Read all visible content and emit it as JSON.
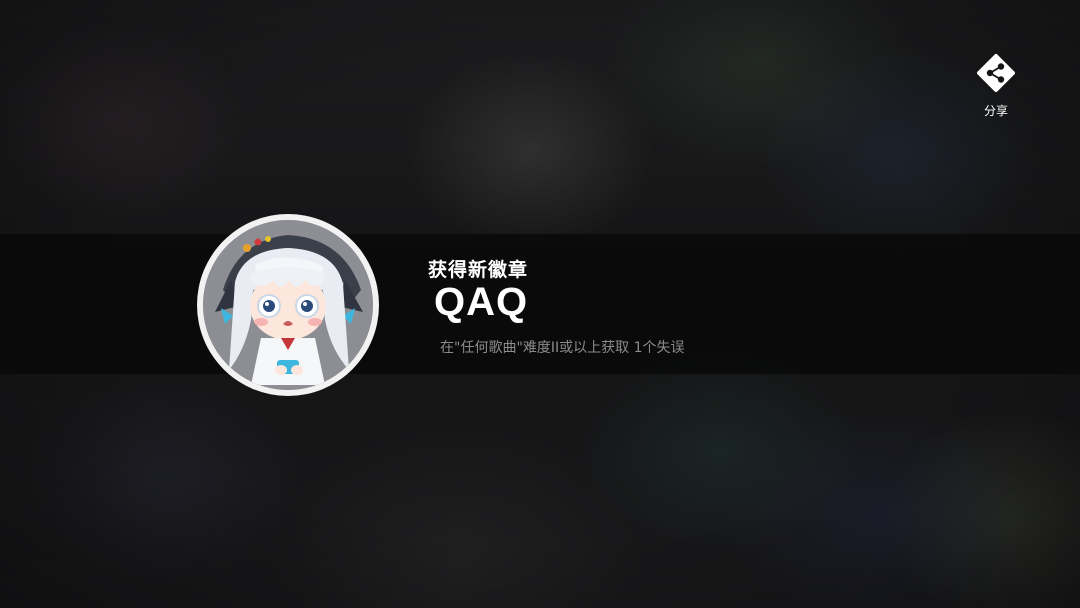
{
  "banner": {
    "heading": "获得新徽章",
    "badge_name": "QAQ",
    "description": "在\"任何歌曲\"难度II或以上获取 1个失误"
  },
  "share": {
    "label": "分享",
    "icon": "share-icon"
  },
  "badge": {
    "icon": "badge-image",
    "ring_color": "#f2f2f2"
  },
  "colors": {
    "banner_bg": "#080808",
    "text_primary": "#ffffff",
    "text_secondary": "#8c8c8c"
  }
}
